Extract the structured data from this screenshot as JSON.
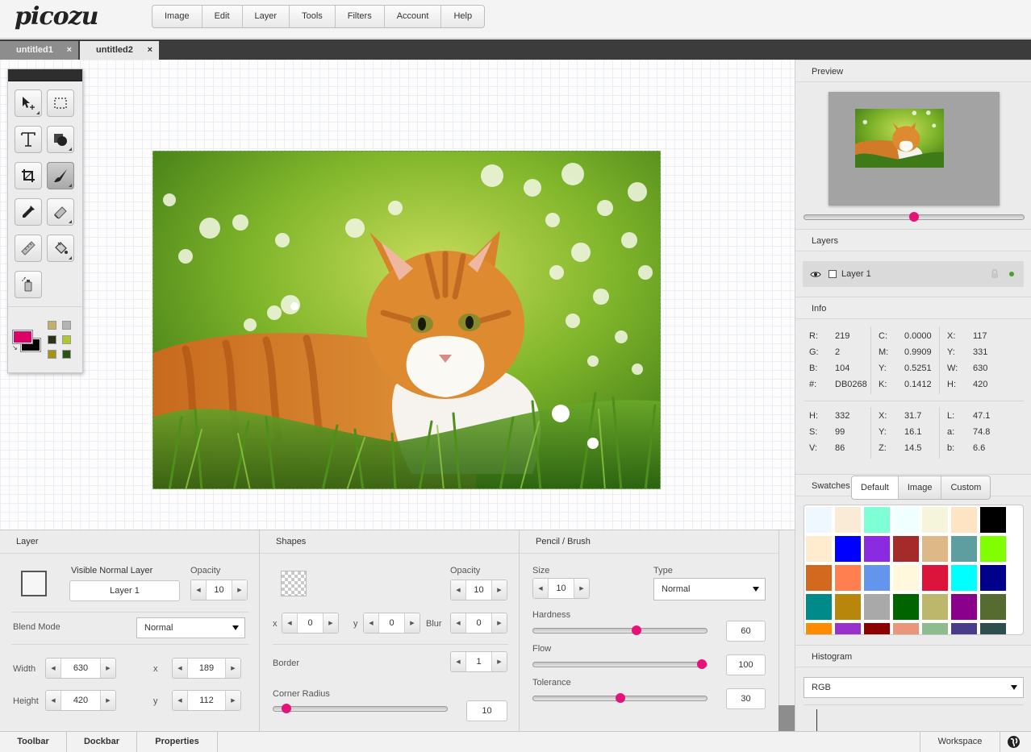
{
  "app": {
    "logo": "picozu"
  },
  "menu": [
    "Image",
    "Edit",
    "Layer",
    "Tools",
    "Filters",
    "Account",
    "Help"
  ],
  "doc_tabs": [
    {
      "label": "untitled1",
      "close": "×"
    },
    {
      "label": "untitled2",
      "close": "×"
    }
  ],
  "colors": {
    "foreground": "#DB0268",
    "background": "#000000",
    "accent": "#e6127a"
  },
  "mini_swatches": [
    "#c4ae69",
    "#b3b3b3",
    "#2e3218",
    "#b1c72d",
    "#a39416",
    "#2c5312"
  ],
  "preview": {
    "title": "Preview",
    "zoom": 0.5
  },
  "layers": {
    "title": "Layers",
    "items": [
      {
        "name": "Layer 1"
      }
    ]
  },
  "info": {
    "title": "Info",
    "rgb": [
      [
        "R:",
        "219"
      ],
      [
        "G:",
        "2"
      ],
      [
        "B:",
        "104"
      ],
      [
        "#:",
        "DB0268"
      ]
    ],
    "cmyk": [
      [
        "C:",
        "0.0000"
      ],
      [
        "M:",
        "0.9909"
      ],
      [
        "Y:",
        "0.5251"
      ],
      [
        "K:",
        "0.1412"
      ]
    ],
    "pos": [
      [
        "X:",
        "117"
      ],
      [
        "Y:",
        "331"
      ],
      [
        "W:",
        "630"
      ],
      [
        "H:",
        "420"
      ]
    ],
    "hsv": [
      [
        "H:",
        "332"
      ],
      [
        "S:",
        "99"
      ],
      [
        "V:",
        "86"
      ]
    ],
    "xyz": [
      [
        "X:",
        "31.7"
      ],
      [
        "Y:",
        "16.1"
      ],
      [
        "Z:",
        "14.5"
      ]
    ],
    "lab": [
      [
        "L:",
        "47.1"
      ],
      [
        "a:",
        "74.8"
      ],
      [
        "b:",
        "6.6"
      ]
    ]
  },
  "swatches": {
    "title": "Swatches",
    "tabs": [
      "Default",
      "Image",
      "Custom"
    ],
    "active_tab": "Default",
    "colors": [
      "#f0f8ff",
      "#faebd7",
      "#7fffd4",
      "#f0ffff",
      "#f5f5dc",
      "#ffe4c4",
      "#000000",
      "#ffebcd",
      "#0000ff",
      "#8a2be2",
      "#a52a2a",
      "#deb887",
      "#5f9ea0",
      "#7fff00",
      "#d2691e",
      "#ff7f50",
      "#6495ed",
      "#fff8dc",
      "#dc143c",
      "#00ffff",
      "#00008b",
      "#008b8b",
      "#b8860b",
      "#a9a9a9",
      "#006400",
      "#bdb76b",
      "#8b008b",
      "#556b2f",
      "#ff8c00",
      "#9932cc",
      "#8b0000",
      "#e9967a",
      "#8fbc8f",
      "#483d8b",
      "#2f4f4f"
    ]
  },
  "histogram": {
    "title": "Histogram",
    "channel": "RGB"
  },
  "layer_panel": {
    "title": "Layer",
    "visible_label": "Visible Normal Layer",
    "layer_name": "Layer 1",
    "opacity_label": "Opacity",
    "opacity": "10",
    "blend_label": "Blend Mode",
    "blend": "Normal",
    "width_label": "Width",
    "width": "630",
    "height_label": "Height",
    "height": "420",
    "x_label": "x",
    "x": "189",
    "y_label": "y",
    "y": "112"
  },
  "shapes_panel": {
    "title": "Shapes",
    "opacity_label": "Opacity",
    "opacity": "10",
    "x_label": "x",
    "x": "0",
    "y_label": "y",
    "y": "0",
    "blur_label": "Blur",
    "blur": "0",
    "border_label": "Border",
    "border": "1",
    "radius_label": "Corner Radius",
    "radius": "10",
    "radius_level": 0.05
  },
  "brush_panel": {
    "title": "Pencil / Brush",
    "size_label": "Size",
    "size": "10",
    "type_label": "Type",
    "type": "Normal",
    "hardness_label": "Hardness",
    "hardness": "60",
    "hardness_level": 0.6,
    "flow_label": "Flow",
    "flow": "100",
    "flow_level": 1.0,
    "tolerance_label": "Tolerance",
    "tolerance": "30",
    "tolerance_level": 0.5
  },
  "statusbar": {
    "tabs": [
      "Toolbar",
      "Dockbar",
      "Properties"
    ],
    "workspace": "Workspace"
  }
}
